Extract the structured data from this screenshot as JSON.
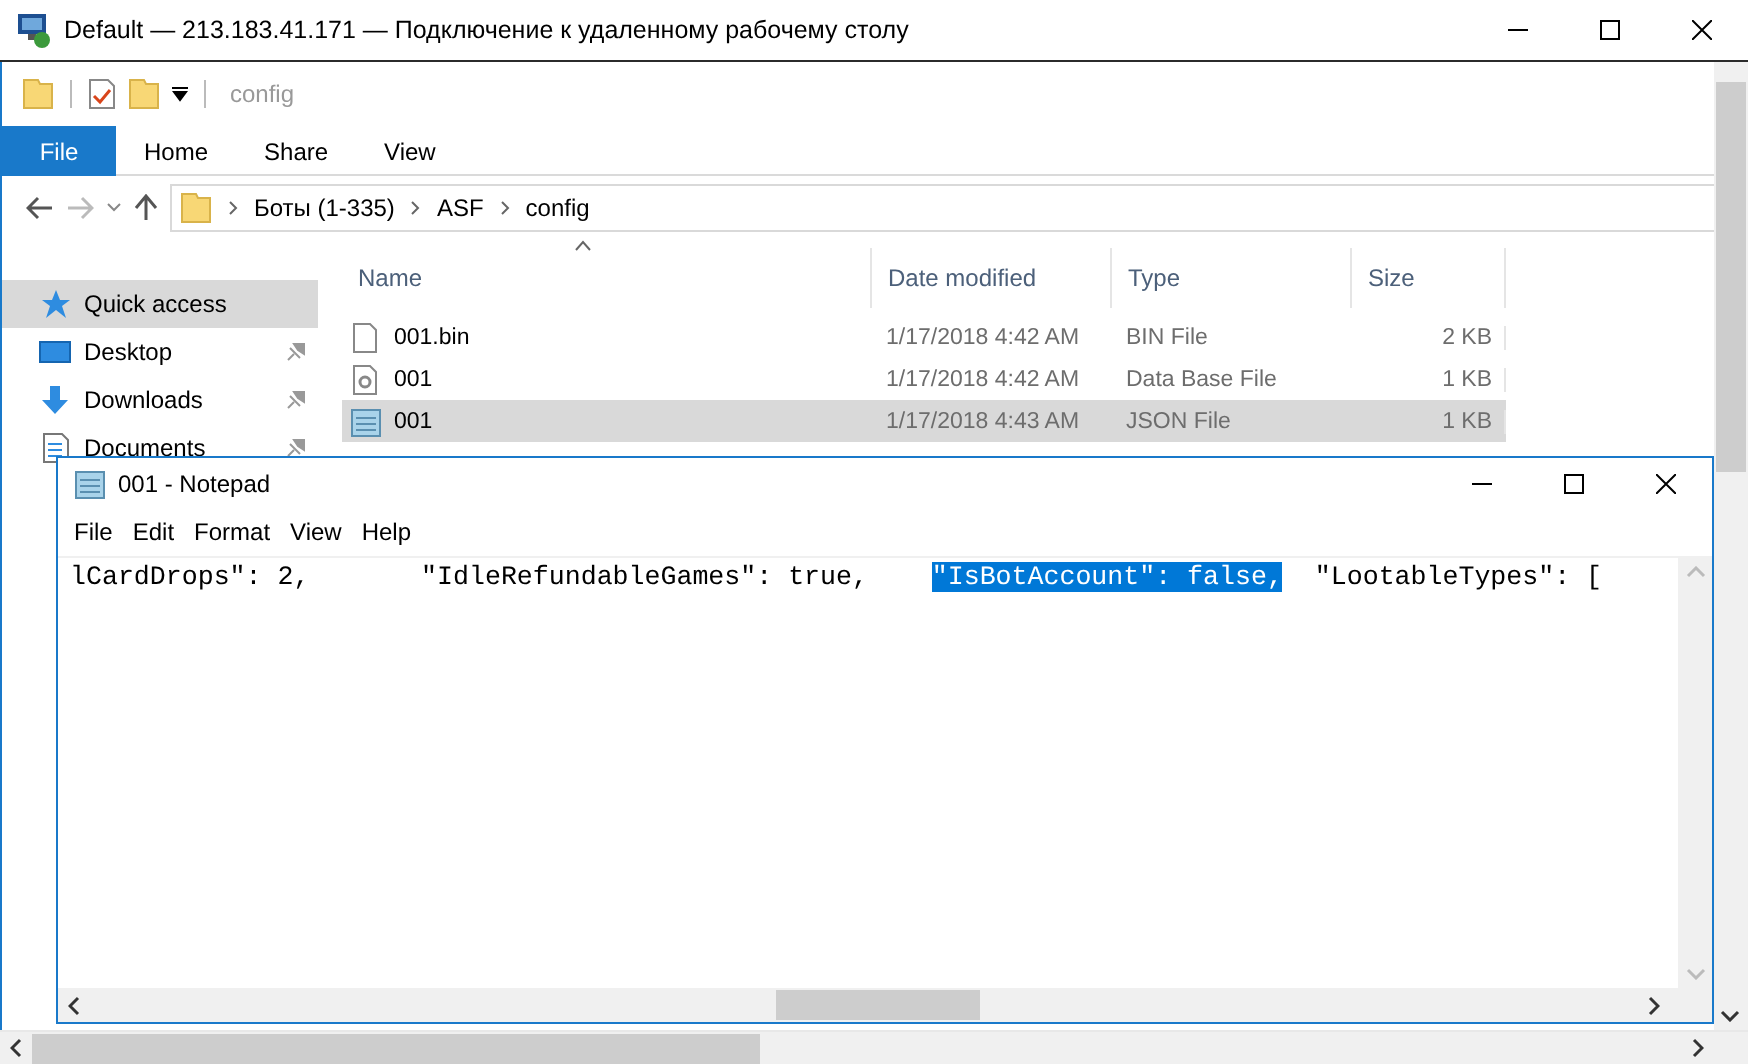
{
  "remote_window": {
    "title": "Default — 213.183.41.171 — Подключение к удаленному рабочему столу"
  },
  "explorer": {
    "quick_access_toolbar": {
      "title": "config"
    },
    "ribbon_tabs": [
      {
        "label": "File",
        "kind": "file",
        "selected": false
      },
      {
        "label": "Home",
        "kind": "tab",
        "selected": false
      },
      {
        "label": "Share",
        "kind": "tab",
        "selected": false
      },
      {
        "label": "View",
        "kind": "tab",
        "selected": false
      }
    ],
    "address": {
      "path": [
        "Боты (1-335)",
        "ASF",
        "config"
      ]
    },
    "navigation": [
      {
        "label": "Quick access",
        "kind": "quick-access",
        "selected": true,
        "pinned": false
      },
      {
        "label": "Desktop",
        "kind": "desktop",
        "selected": false,
        "pinned": true
      },
      {
        "label": "Downloads",
        "kind": "downloads",
        "selected": false,
        "pinned": true
      },
      {
        "label": "Documents",
        "kind": "documents",
        "selected": false,
        "pinned": true
      }
    ],
    "columns": [
      "Name",
      "Date modified",
      "Type",
      "Size"
    ],
    "files": [
      {
        "name": "001.bin",
        "kind": "bin",
        "date": "1/17/2018 4:42 AM",
        "type": "BIN File",
        "size": "2 KB",
        "selected": false
      },
      {
        "name": "001",
        "kind": "database",
        "date": "1/17/2018 4:42 AM",
        "type": "Data Base File",
        "size": "1 KB",
        "selected": false
      },
      {
        "name": "001",
        "kind": "json",
        "date": "1/17/2018 4:43 AM",
        "type": "JSON File",
        "size": "1 KB",
        "selected": true
      }
    ]
  },
  "notepad": {
    "title": "001 - Notepad",
    "menu": [
      "File",
      "Edit",
      "Format",
      "View",
      "Help"
    ],
    "text": [
      {
        "text": "lCardDrops\": 2,       \"IdleRefundableGames\": true,    ",
        "selected": false
      },
      {
        "text": "\"IsBotAccount\": false,",
        "selected": true
      },
      {
        "text": "  \"LootableTypes\": [",
        "selected": false
      }
    ]
  }
}
